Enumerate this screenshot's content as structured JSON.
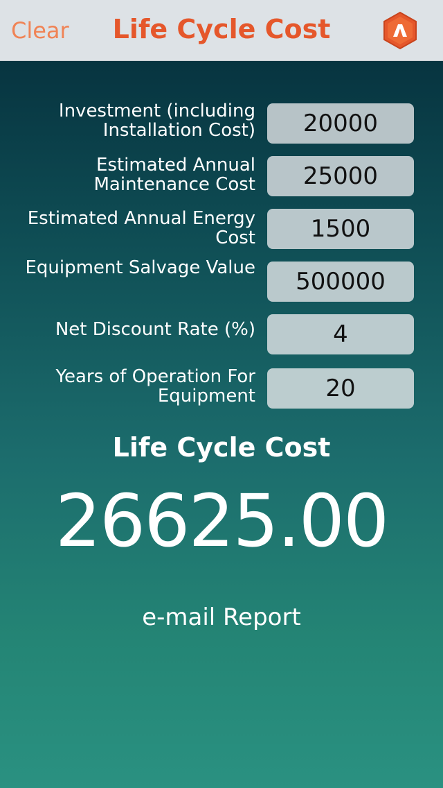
{
  "nav": {
    "clear_label": "Clear",
    "title": "Life Cycle Cost",
    "logo_icon": "app-logo-icon",
    "colors": {
      "accent": "#e5572b",
      "clear": "#f08355",
      "bar": "#dde2e6"
    }
  },
  "form": {
    "fields": [
      {
        "label": "Investment (including Installation Cost)",
        "value": "20000"
      },
      {
        "label": "Estimated Annual Maintenance Cost",
        "value": "25000"
      },
      {
        "label": "Estimated Annual Energy Cost",
        "value": "1500"
      },
      {
        "label": "Equipment Salvage Value",
        "value": "500000"
      },
      {
        "label": "Net Discount Rate (%)",
        "value": "4"
      },
      {
        "label": "Years of Operation For Equipment",
        "value": "20"
      }
    ]
  },
  "result": {
    "title": "Life Cycle Cost",
    "value": "26625.00",
    "email_label": "e-mail Report"
  }
}
